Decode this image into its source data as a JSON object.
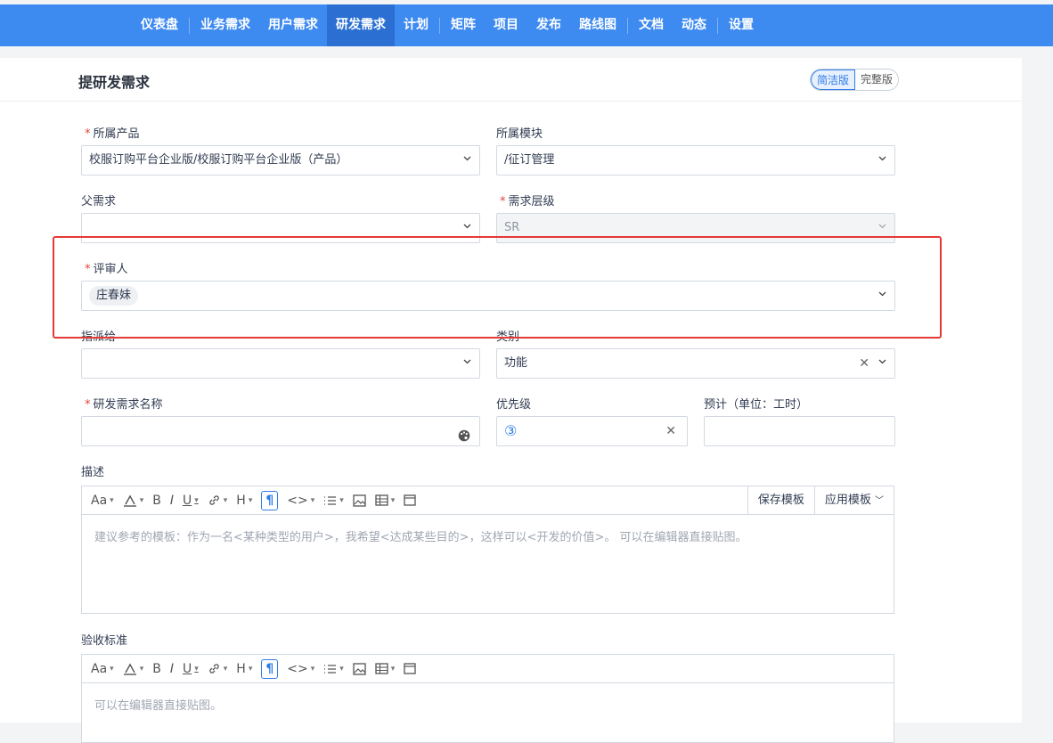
{
  "nav": {
    "items": [
      {
        "label": "仪表盘",
        "active": false,
        "sep_after": true
      },
      {
        "label": "业务需求",
        "active": false
      },
      {
        "label": "用户需求",
        "active": false
      },
      {
        "label": "研发需求",
        "active": true
      },
      {
        "label": "计划",
        "active": false,
        "sep_after": true
      },
      {
        "label": "矩阵",
        "active": false
      },
      {
        "label": "项目",
        "active": false
      },
      {
        "label": "发布",
        "active": false
      },
      {
        "label": "路线图",
        "active": false,
        "sep_after": true
      },
      {
        "label": "文档",
        "active": false
      },
      {
        "label": "动态",
        "active": false,
        "sep_after": true
      },
      {
        "label": "设置",
        "active": false
      }
    ]
  },
  "page": {
    "title": "提研发需求",
    "mode_simple": "简洁版",
    "mode_full": "完整版"
  },
  "form": {
    "product": {
      "label": "所属产品",
      "value": "校服订购平台企业版/校服订购平台企业版（产品）"
    },
    "module": {
      "label": "所属模块",
      "value": "/征订管理"
    },
    "parent": {
      "label": "父需求",
      "value": ""
    },
    "level": {
      "label": "需求层级",
      "value": "SR"
    },
    "reviewer": {
      "label": "评审人",
      "value": "庄春妹"
    },
    "assignee": {
      "label": "指派给",
      "value": ""
    },
    "category": {
      "label": "类别",
      "value": "功能"
    },
    "name": {
      "label": "研发需求名称",
      "value": ""
    },
    "priority": {
      "label": "优先级",
      "value": "③"
    },
    "estimate": {
      "label": "预计（单位：工时）",
      "value": ""
    },
    "description": {
      "label": "描述",
      "placeholder": "建议参考的模板：作为一名<某种类型的用户>，我希望<达成某些目的>，这样可以<开发的价值>。 可以在编辑器直接贴图。"
    },
    "acceptance": {
      "label": "验收标准",
      "placeholder": "可以在编辑器直接贴图。"
    }
  },
  "editor_toolbar": {
    "font_size": "Aa",
    "bold": "B",
    "italic": "I",
    "underline": "U",
    "heading": "H",
    "paragraph": "¶",
    "code": "<>",
    "save_template": "保存模板",
    "apply_template": "应用模板"
  },
  "colors": {
    "nav_bg": "#3d8af0",
    "accent": "#2e7ce6",
    "required": "#e5413a",
    "highlight_box": "#e53935"
  }
}
